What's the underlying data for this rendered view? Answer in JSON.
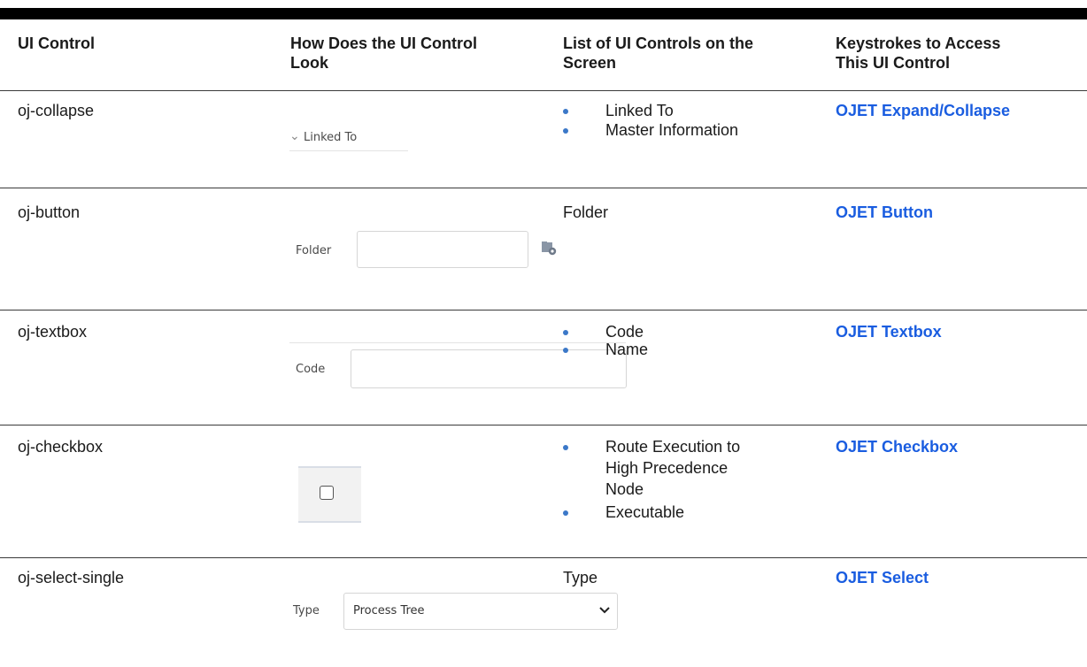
{
  "headers": {
    "ui_control": "UI Control",
    "look_line1": "How Does the UI Control",
    "look_line2": "Look",
    "list_line1": "List of UI Controls on the",
    "list_line2": "Screen",
    "keys_line1": "Keystrokes to Access",
    "keys_line2": "This UI Control"
  },
  "rows": [
    {
      "control": "oj-collapse",
      "mock_label": "Linked To",
      "list": [
        "Linked To",
        "Master Information"
      ],
      "link": "OJET Expand/Collapse"
    },
    {
      "control": "oj-button",
      "mock_label": "Folder",
      "list_plain": "Folder",
      "link": "OJET Button"
    },
    {
      "control": "oj-textbox",
      "mock_label": "Code",
      "list": [
        "Code",
        "Name"
      ],
      "link": "OJET Textbox"
    },
    {
      "control": "oj-checkbox",
      "list": [
        "Route Execution to",
        "High Precedence",
        "Node",
        "Executable"
      ],
      "link": "OJET Checkbox"
    },
    {
      "control": "oj-select-single",
      "mock_label": "Type",
      "mock_value": "Process Tree",
      "list_plain": "Type",
      "link": "OJET Select"
    }
  ],
  "colors": {
    "link": "#1a5de0",
    "bullet": "#3b78c8",
    "rule": "#000000"
  }
}
